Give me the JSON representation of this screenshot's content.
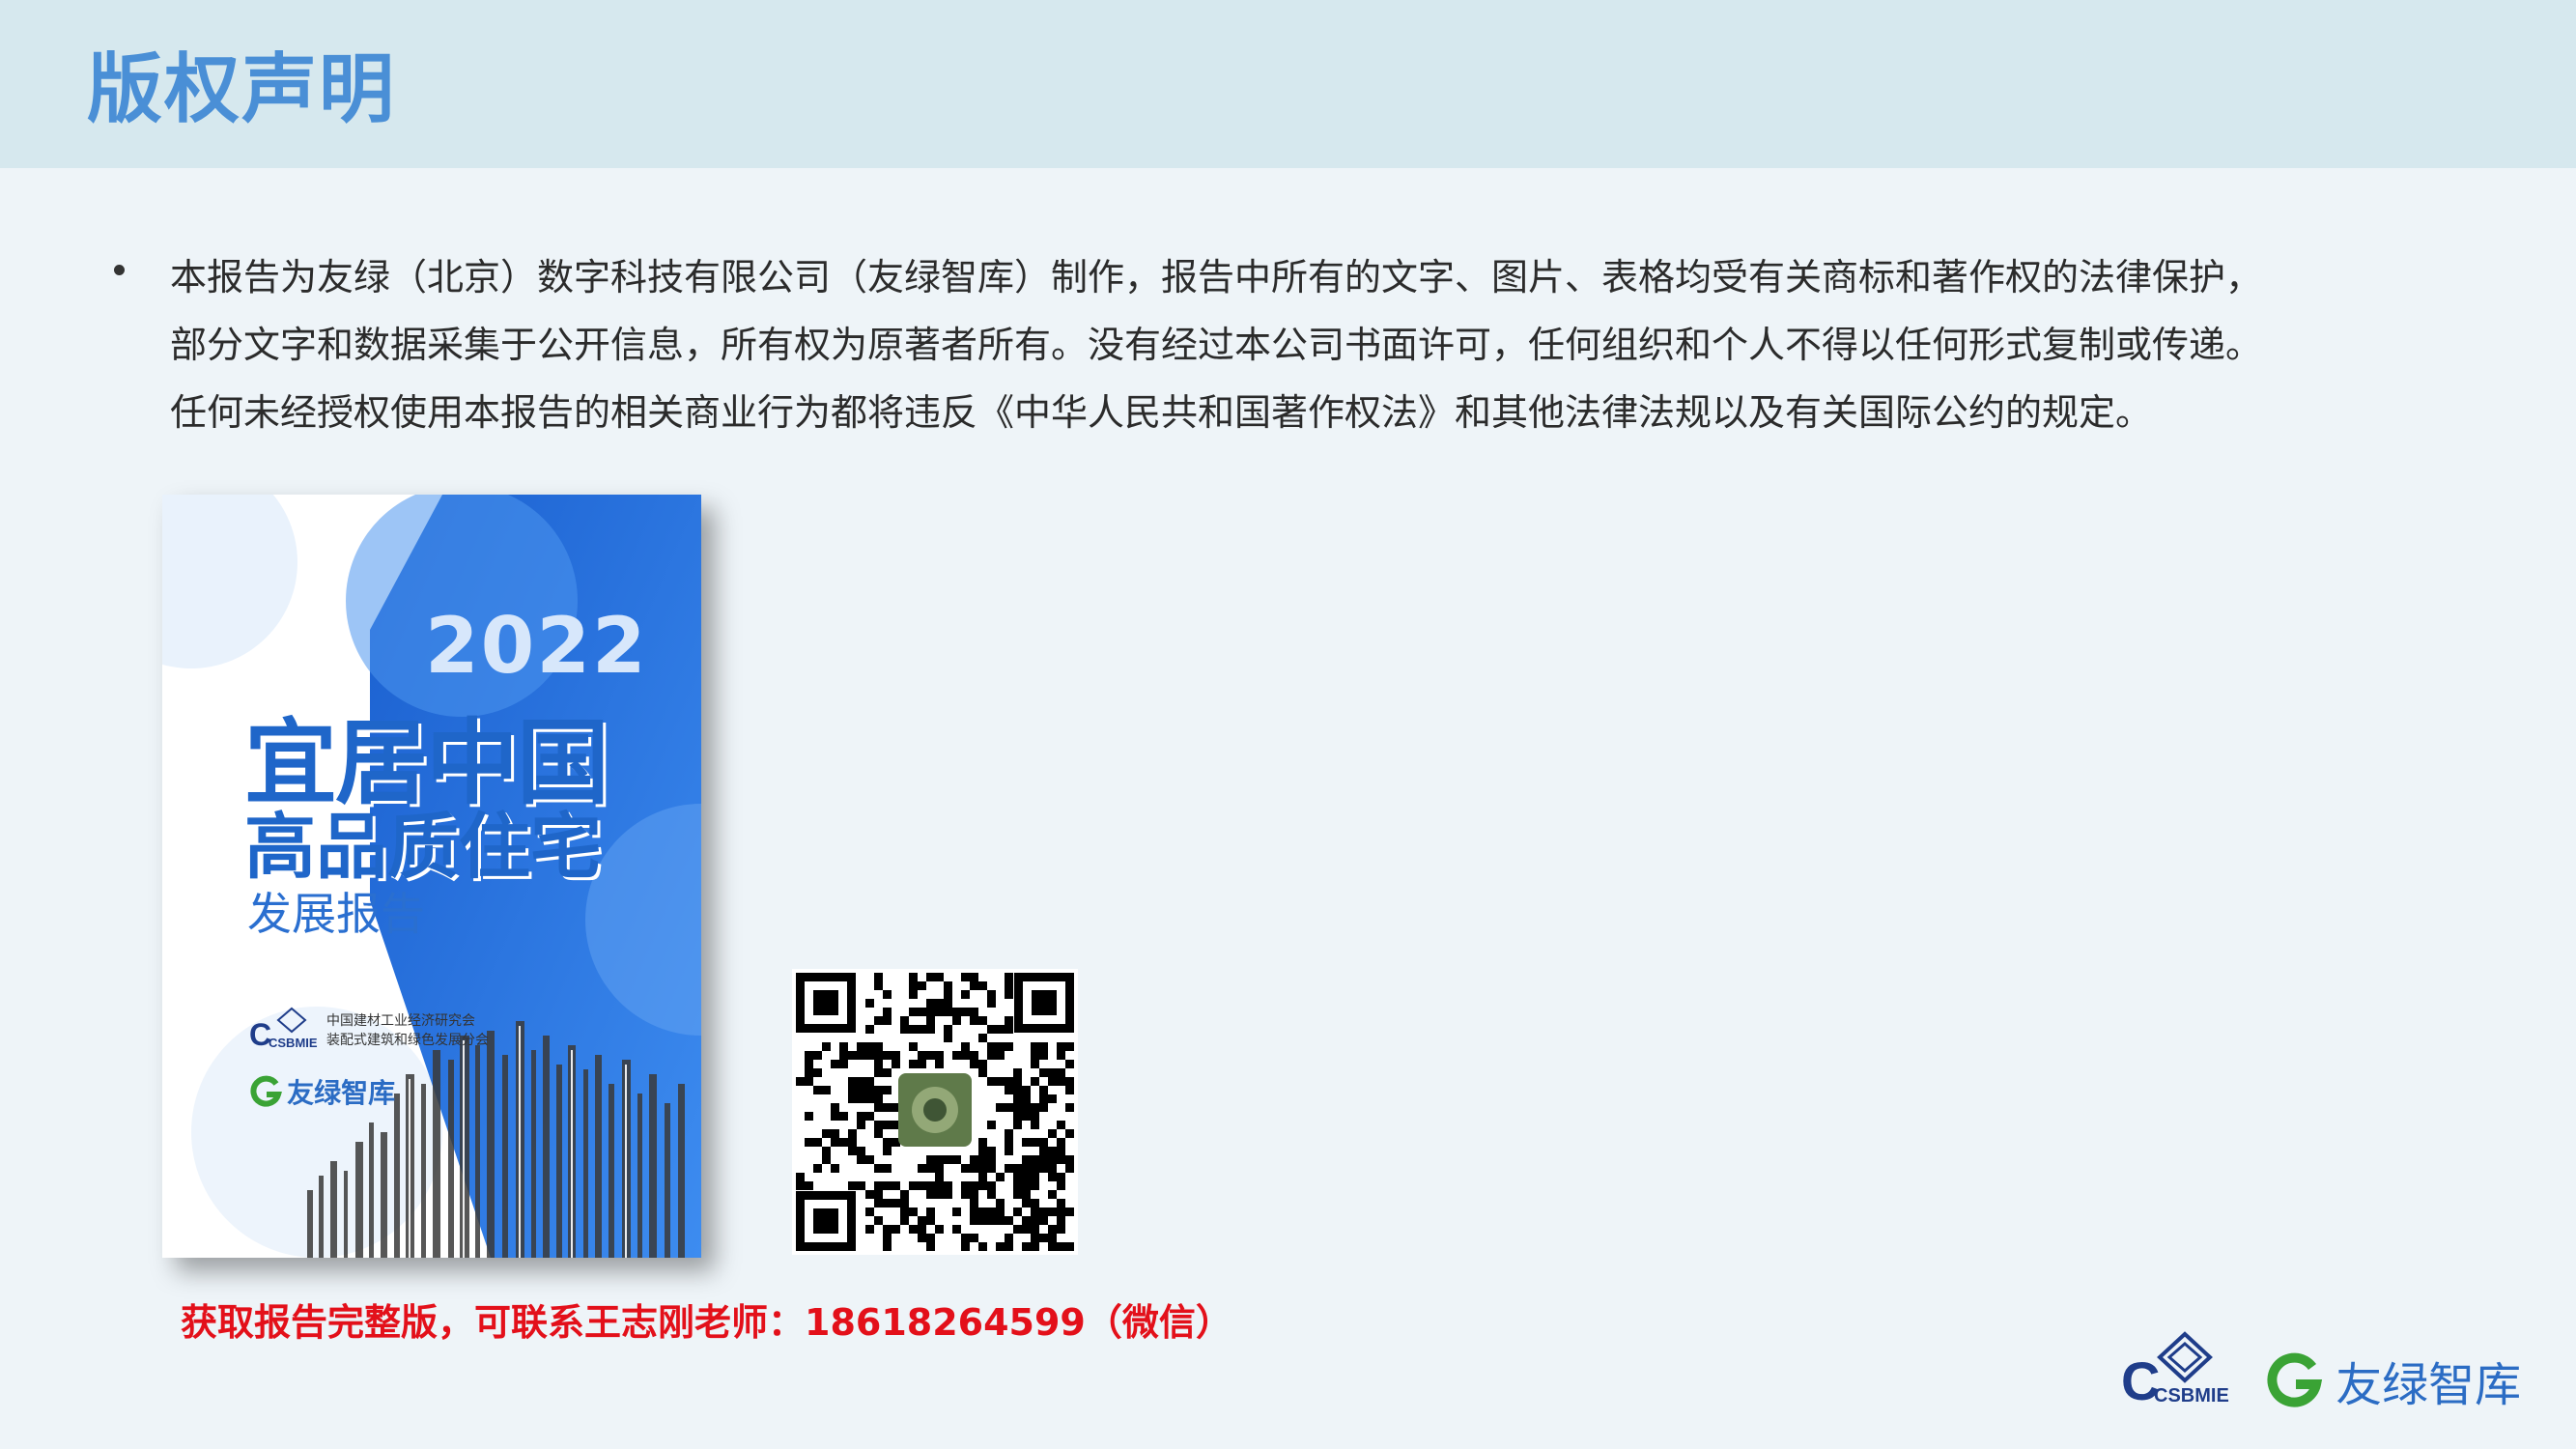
{
  "header": {
    "title": "版权声明"
  },
  "statement": {
    "lines": [
      "本报告为友绿（北京）数字科技有限公司（友绿智库）制作，报告中所有的文字、图片、表格均受有关商标和著作权的法律保护，",
      "部分文字和数据采集于公开信息，所有权为原著者所有。没有经过本公司书面许可，任何组织和个人不得以任何形式复制或传递。",
      "任何未经授权使用本报告的相关商业行为都将违反《中华人民共和国著作权法》和其他法律法规以及有关国际公约的规定。"
    ]
  },
  "cover": {
    "year": "2022",
    "title_line1": "宜居中国",
    "title_line2": "高品质住宅",
    "subtitle": "发展报告",
    "org_line1": "中国建材工业经济研究会",
    "org_line2": "装配式建筑和绿色发展分会",
    "org_logo_text": "CSBMIE",
    "brand": "友绿智库"
  },
  "contact": {
    "text": "获取报告完整版，可联系王志刚老师：18618264599（微信）"
  },
  "footer": {
    "logo_csbmie": "CSBMIE",
    "brand": "友绿智库"
  },
  "colors": {
    "accent": "#4a8fd6",
    "cover_blue": "#1f66c9",
    "contact_red": "#e3101a",
    "brand_green": "#3aa335"
  }
}
